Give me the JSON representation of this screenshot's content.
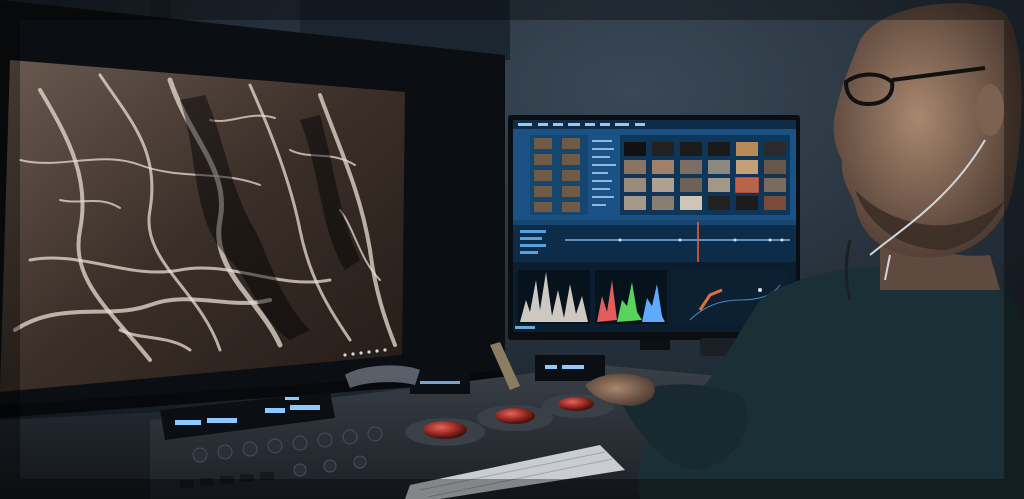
{
  "scene": {
    "colors": {
      "wall": "#27323d",
      "desk": "#20262d",
      "screen_blue": "#1f5f96",
      "lcd_blue": "#8ec9ff",
      "trackball_red": "#b33a2e",
      "skin": "#9a7a66"
    },
    "objects": [
      {
        "name": "left-grading-monitor",
        "content": "macro-texture-image"
      },
      {
        "name": "right-ui-monitor",
        "content": "color-grading-software"
      },
      {
        "name": "grading-control-panel"
      },
      {
        "name": "keyboard"
      },
      {
        "name": "colorist-person"
      }
    ]
  },
  "panel_lcd": {
    "left": "",
    "right": ""
  }
}
